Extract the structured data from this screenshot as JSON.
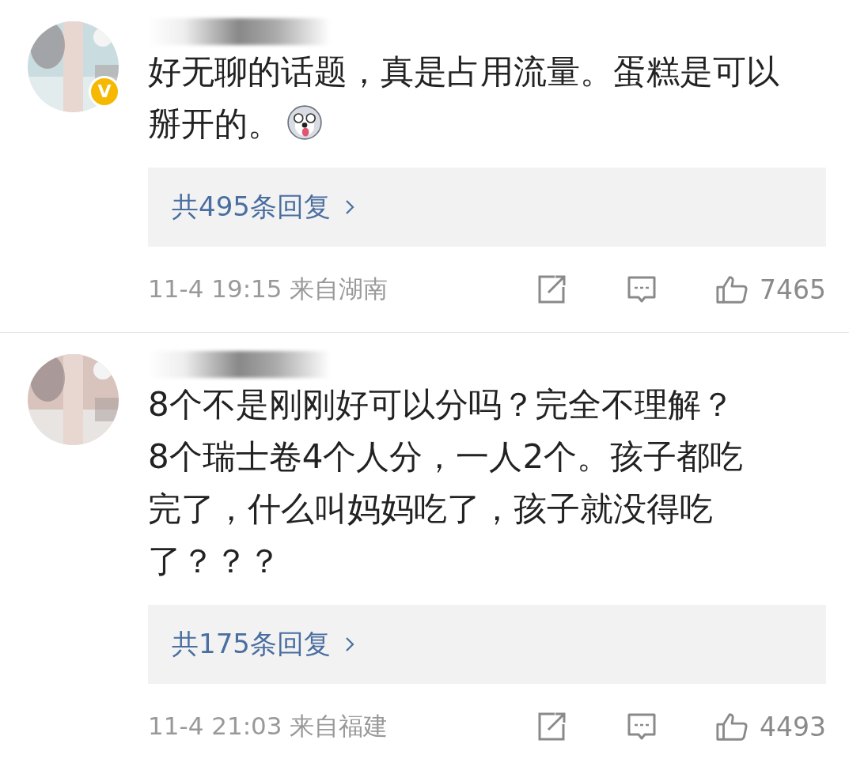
{
  "comments": [
    {
      "verified": true,
      "badge": "V",
      "lines": [
        "好无聊的话题，真是占用流量。蛋糕是可以",
        "掰开的。"
      ],
      "sticker": true,
      "replies": "共495条回复",
      "time": "11-4 19:15 来自湖南",
      "likes": "7465"
    },
    {
      "lines": [
        "8个不是刚刚好可以分吗？完全不理解？",
        "8个瑞士卷4个人分，一人2个。孩子都吃",
        "完了，什么叫妈妈吃了，孩子就没得吃",
        "了？？？"
      ],
      "replies": "共175条回复",
      "time": "11-4 21:03 来自福建",
      "likes": "4493"
    }
  ]
}
